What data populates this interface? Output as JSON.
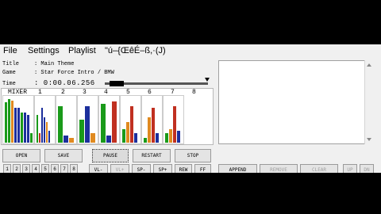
{
  "menu": {
    "file": "File",
    "settings": "Settings",
    "playlist": "Playlist",
    "extra": "\"ú–{ŒêÉ–ß,·(J)"
  },
  "info": {
    "title_label": "Title",
    "title_value": ": Main Theme",
    "game_label": "Game",
    "game_value": ": Star Force Intro / BMW",
    "time_label": "Time",
    "time_value": ": 0:00.06.256",
    "seek_position": 0.05
  },
  "mixer": {
    "label": "MIXER",
    "channels": [
      "1",
      "2",
      "3",
      "4",
      "5",
      "6",
      "7",
      "8"
    ]
  },
  "buttons": {
    "open": "OPEN",
    "save": "SAVE",
    "pause": "PAUSE",
    "restart": "RESTART",
    "stop": "STOP",
    "vol_down": "VL-",
    "vol_up": "VL+",
    "speed_down": "SP-",
    "speed_up": "SP+",
    "rewind": "REW",
    "fast_forward": "FF",
    "append": "APPEND",
    "remove": "REMOVE",
    "clear": "CLEAR",
    "up": "UP",
    "down": "DN"
  },
  "colors": {
    "green": "#1a9a1a",
    "orange": "#e08a20",
    "blue": "#1c2f9c",
    "red": "#c03020"
  }
}
